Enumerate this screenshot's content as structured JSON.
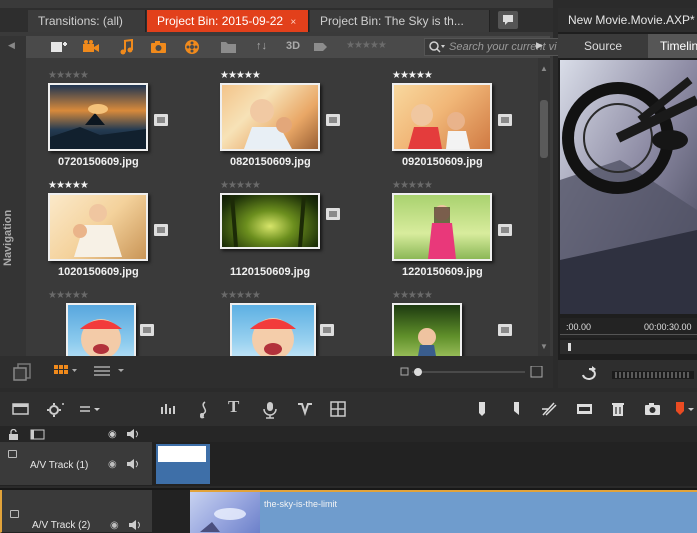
{
  "library": {
    "tabs": [
      {
        "label": "Transitions: (all)"
      },
      {
        "label": "Project Bin: 2015-09-22",
        "close": "×"
      },
      {
        "label": "Project Bin: The Sky is th..."
      }
    ],
    "toolbar": {
      "sort_label": "↑↓",
      "stereo_label": "3D",
      "rating_stars": "★★★★★",
      "search_placeholder": "Search your current vi"
    },
    "navigation_label": "Navigation",
    "items": [
      {
        "name": "0720150609.jpg",
        "stars": "★★★★★",
        "rated": false
      },
      {
        "name": "0820150609.jpg",
        "stars": "★★★★★",
        "rated": true
      },
      {
        "name": "0920150609.jpg",
        "stars": "★★★★★",
        "rated": true
      },
      {
        "name": "1020150609.jpg",
        "stars": "★★★★★",
        "rated": true
      },
      {
        "name": "1120150609.jpg",
        "stars": "★★★★★",
        "rated": false
      },
      {
        "name": "1220150609.jpg",
        "stars": "★★★★★",
        "rated": false
      },
      {
        "name": "",
        "stars": "★★★★★",
        "rated": false
      },
      {
        "name": "",
        "stars": "★★★★★",
        "rated": false
      },
      {
        "name": "",
        "stars": "★★★★★",
        "rated": false
      }
    ]
  },
  "player": {
    "title": "New Movie.Movie.AXP*",
    "tabs": [
      "Source",
      "Timeline"
    ],
    "active_tab": "Timeline",
    "timecode_start": ":00.00",
    "timecode_end": "00:00:30.00"
  },
  "timeline": {
    "tracks": [
      {
        "label": "A/V Track (1)"
      },
      {
        "label": "A/V Track (2)",
        "clip": "the-sky-is-the-limit"
      }
    ]
  },
  "colors": {
    "accent": "#e2401b",
    "orange_icon": "#f08a1c",
    "clip_blue": "#3e6fa8"
  }
}
